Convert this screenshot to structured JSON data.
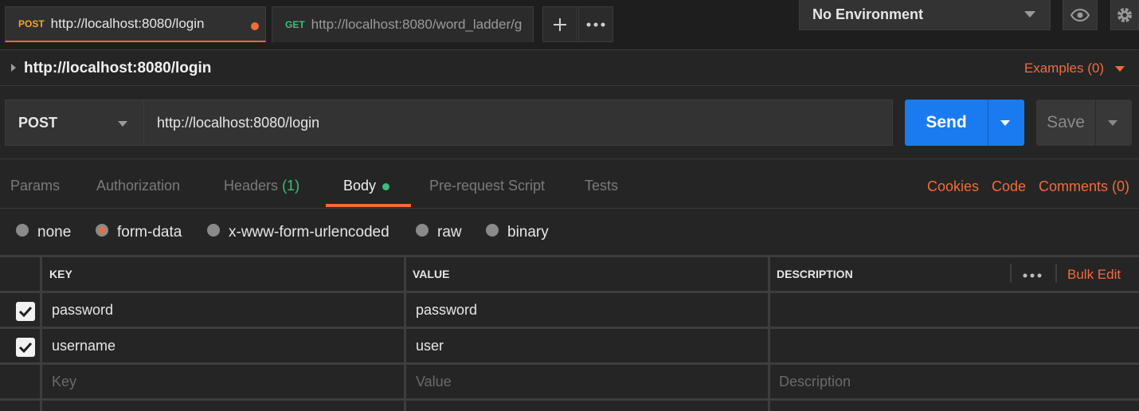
{
  "tabs": [
    {
      "method": "POST",
      "url": "http://localhost:8080/login",
      "active": true,
      "unsaved": true
    },
    {
      "method": "GET",
      "url": "http://localhost:8080/word_ladder/g",
      "active": false
    }
  ],
  "toolbar": {
    "add_icon": "plus-icon",
    "more_icon": "ellipsis-icon"
  },
  "environment": {
    "selected": "No Environment",
    "eye_icon": "eye-icon",
    "settings_icon": "gear-icon"
  },
  "request": {
    "name": "http://localhost:8080/login",
    "examples_label": "Examples (0)",
    "method": "POST",
    "url": "http://localhost:8080/login",
    "send_label": "Send",
    "save_label": "Save"
  },
  "subtabs": {
    "params": "Params",
    "authorization": "Authorization",
    "headers": "Headers",
    "headers_count": "(1)",
    "body": "Body",
    "prerequest": "Pre-request Script",
    "tests": "Tests",
    "cookies": "Cookies",
    "code": "Code",
    "comments": "Comments (0)"
  },
  "body_types": {
    "none": "none",
    "form_data": "form-data",
    "urlencoded": "x-www-form-urlencoded",
    "raw": "raw",
    "binary": "binary",
    "selected": "form-data"
  },
  "table": {
    "headers": {
      "key": "KEY",
      "value": "VALUE",
      "description": "DESCRIPTION"
    },
    "bulk_edit": "Bulk Edit",
    "rows": [
      {
        "key": "password",
        "value": "password",
        "description": "",
        "checked": true
      },
      {
        "key": "username",
        "value": "user",
        "description": "",
        "checked": true
      }
    ],
    "placeholder": {
      "key": "Key",
      "value": "Value",
      "description": "Description"
    }
  },
  "colors": {
    "accent": "#f26b3a",
    "send": "#1a7bf0",
    "success": "#3cbf7a"
  }
}
